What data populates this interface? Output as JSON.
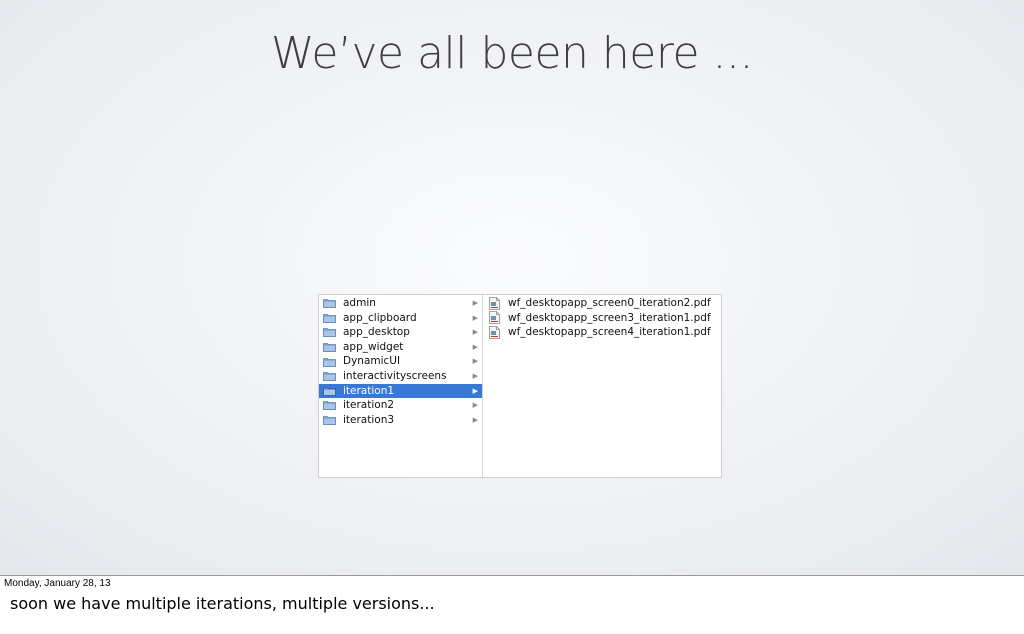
{
  "slide": {
    "title": "We’ve all been here ..."
  },
  "finder": {
    "folders": [
      {
        "label": "admin",
        "icon": "folder-icon",
        "selected": false
      },
      {
        "label": "app_clipboard",
        "icon": "folder-icon",
        "selected": false
      },
      {
        "label": "app_desktop",
        "icon": "folder-icon",
        "selected": false
      },
      {
        "label": "app_widget",
        "icon": "folder-icon",
        "selected": false
      },
      {
        "label": "DynamicUI",
        "icon": "folder-icon",
        "selected": false
      },
      {
        "label": "interactivityscreens",
        "icon": "folder-icon",
        "selected": false
      },
      {
        "label": "iteration1",
        "icon": "folder-icon",
        "selected": true
      },
      {
        "label": "iteration2",
        "icon": "folder-icon",
        "selected": false
      },
      {
        "label": "iteration3",
        "icon": "folder-icon",
        "selected": false
      }
    ],
    "files": [
      {
        "label": "wf_desktopapp_screen0_iteration2.pdf",
        "icon": "pdf-file-icon"
      },
      {
        "label": "wf_desktopapp_screen3_iteration1.pdf",
        "icon": "pdf-file-icon"
      },
      {
        "label": "wf_desktopapp_screen4_iteration1.pdf",
        "icon": "pdf-file-icon"
      }
    ],
    "colors": {
      "selection": "#3a78d8",
      "folder": "#8fb4dc"
    }
  },
  "notes": {
    "date": "Monday, January 28, 13",
    "text": "soon we have multiple iterations, multiple versions..."
  }
}
